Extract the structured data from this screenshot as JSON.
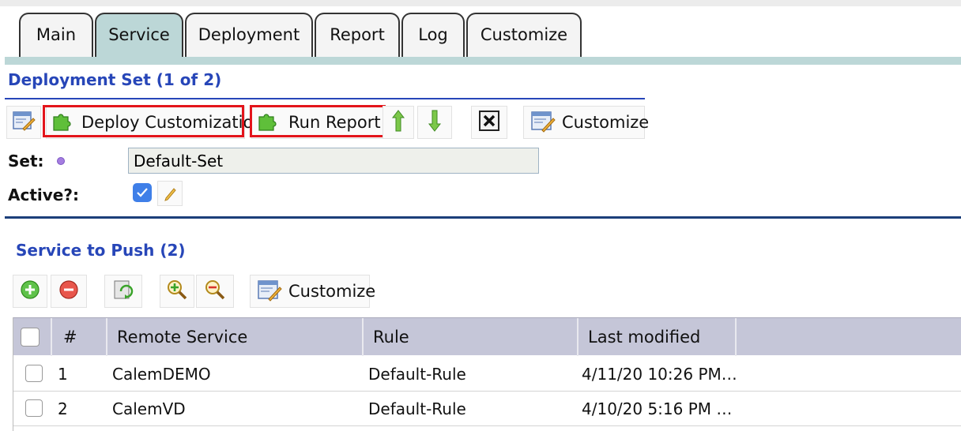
{
  "tabs": [
    {
      "label": "Main"
    },
    {
      "label": "Service"
    },
    {
      "label": "Deployment"
    },
    {
      "label": "Report"
    },
    {
      "label": "Log"
    },
    {
      "label": "Customize"
    }
  ],
  "active_tab": "Service",
  "deployment_set": {
    "title": "Deployment Set (1 of 2)",
    "toolbar": {
      "deploy_label": "Deploy Customization",
      "run_report_label": "Run Report",
      "customize_label": "Customize"
    },
    "set_label": "Set:",
    "set_value": "Default-Set",
    "active_label": "Active?:",
    "active_checked": true
  },
  "service_to_push": {
    "title": "Service to Push (2)",
    "toolbar": {
      "customize_label": "Customize"
    },
    "columns": [
      "#",
      "Remote Service",
      "Rule",
      "Last modified"
    ],
    "rows": [
      {
        "num": "1",
        "remote_service": "CalemDEMO",
        "rule": "Default-Rule",
        "last_modified": "4/11/20 10:26 PM…"
      },
      {
        "num": "2",
        "remote_service": "CalemVD",
        "rule": "Default-Rule",
        "last_modified": "4/10/20 5:16 PM …"
      }
    ]
  },
  "colors": {
    "accent_blue": "#2746b8",
    "active_tab": "#bcd7d7",
    "highlight_red": "#e3141b"
  }
}
